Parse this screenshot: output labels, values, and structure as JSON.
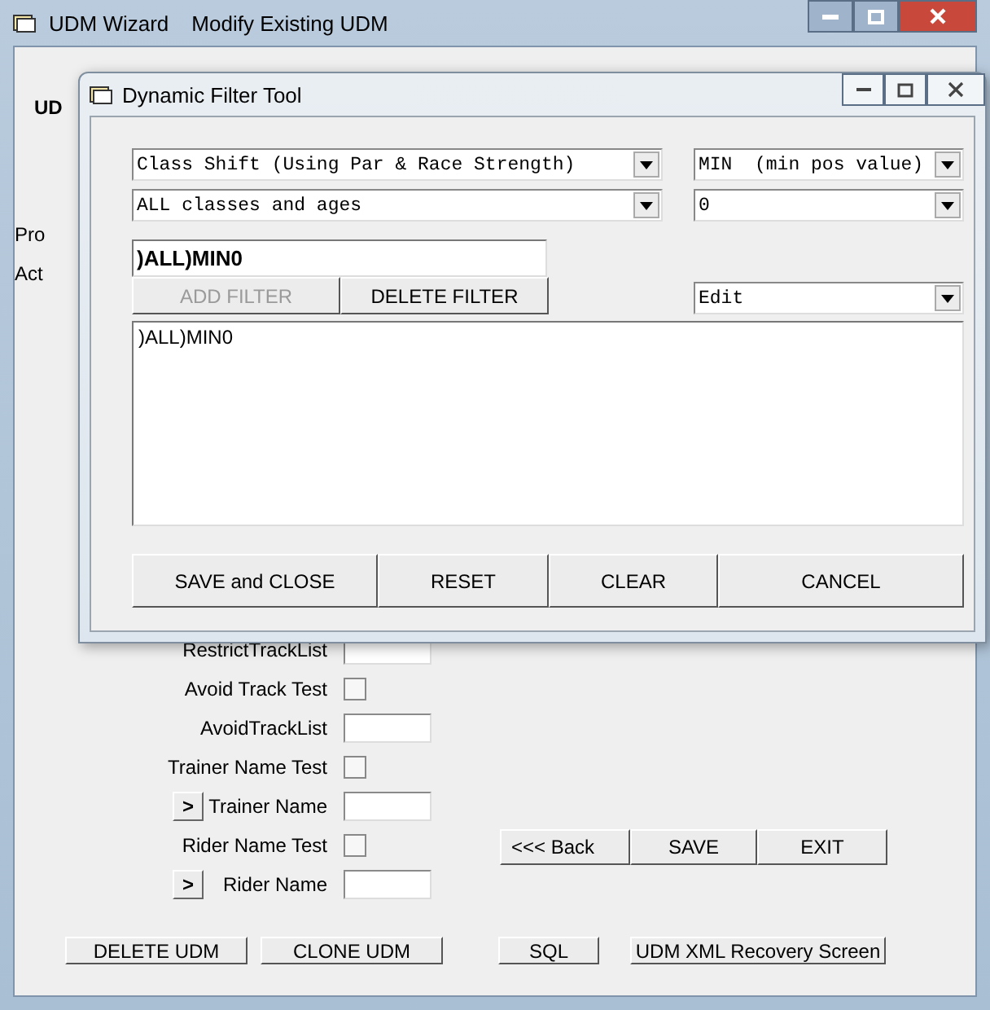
{
  "main_window": {
    "title": "UDM Wizard",
    "subtitle": "Modify Existing UDM"
  },
  "background_labels": [
    "UD",
    "Pro",
    "Act"
  ],
  "form_rows": [
    {
      "kind": "text",
      "label": "RestrictTrackList"
    },
    {
      "kind": "checkbox",
      "label": "Avoid Track Test",
      "checked": false
    },
    {
      "kind": "text",
      "label": "AvoidTrackList"
    },
    {
      "kind": "checkbox",
      "label": "Trainer Name Test",
      "checked": false
    },
    {
      "kind": "picker",
      "label": "Trainer Name",
      "button": ">"
    },
    {
      "kind": "checkbox",
      "label": "Rider Name Test",
      "checked": false
    },
    {
      "kind": "picker",
      "label": "Rider Name",
      "button": ">"
    }
  ],
  "nav_buttons": [
    "<<< Back",
    "SAVE",
    "EXIT"
  ],
  "bottom_buttons": [
    "DELETE UDM",
    "CLONE UDM",
    "SQL",
    "UDM XML Recovery Screen"
  ],
  "dialog": {
    "title": "Dynamic Filter Tool",
    "factor_select": "Class Shift (Using Par & Race Strength)",
    "mode_select": "MIN  (min pos value)",
    "class_select": "ALL classes and ages",
    "value_select": "0",
    "filter_input": ")ALL)MIN0",
    "filter_buttons": [
      {
        "label": "ADD FILTER",
        "disabled": true
      },
      {
        "label": "DELETE FILTER",
        "disabled": false
      }
    ],
    "action_select": "Edit",
    "filter_list": ")ALL)MIN0",
    "buttons": [
      "SAVE and CLOSE",
      "RESET",
      "CLEAR",
      "CANCEL"
    ]
  }
}
